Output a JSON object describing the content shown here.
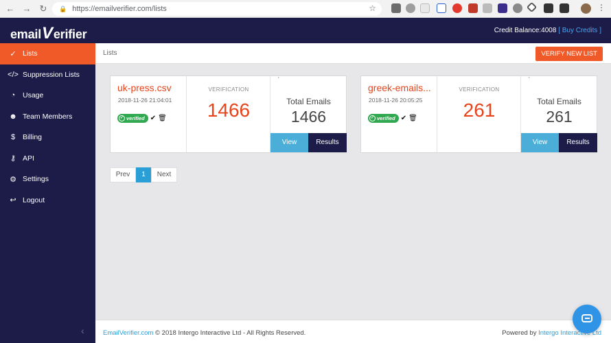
{
  "browser": {
    "url": "https://emailverifier.com/lists",
    "back_icon": "arrow-left",
    "forward_icon": "arrow-right",
    "reload_icon": "reload"
  },
  "header": {
    "logo_part1": "email",
    "logo_v": "V",
    "logo_part2": "erifier",
    "credit_label": "Credit Balance:4008",
    "buy_open": "[",
    "buy_credits": "Buy Credits",
    "buy_close": "]"
  },
  "sidebar": {
    "items": [
      {
        "label": "Lists",
        "icon": "check-circle"
      },
      {
        "label": "Suppression Lists",
        "icon": "code"
      },
      {
        "label": "Usage",
        "icon": "pie-chart"
      },
      {
        "label": "Team Members",
        "icon": "users"
      },
      {
        "label": "Billing",
        "icon": "dollar"
      },
      {
        "label": "API",
        "icon": "key"
      },
      {
        "label": "Settings",
        "icon": "gear"
      },
      {
        "label": "Logout",
        "icon": "logout"
      }
    ]
  },
  "page": {
    "title": "Lists",
    "verify_button": "VERIFY NEW LIST"
  },
  "cards": [
    {
      "filename": "uk-press.csv",
      "date": "2018-11-26 21:04:01",
      "status": "verified",
      "verification_label": "VERIFICATION",
      "verification_value": "1466",
      "total_label": "Total Emails",
      "total_value": "1466",
      "view_label": "View",
      "results_label": "Results"
    },
    {
      "filename": "greek-emails...",
      "date": "2018-11-26 20:05:25",
      "status": "verified",
      "verification_label": "VERIFICATION",
      "verification_value": "261",
      "total_label": "Total Emails",
      "total_value": "261",
      "view_label": "View",
      "results_label": "Results"
    }
  ],
  "pagination": {
    "prev": "Prev",
    "current": "1",
    "next": "Next"
  },
  "footer": {
    "site_link": "EmailVerifier.com",
    "copyright": " © 2018 Intergo Interactive Ltd - All Rights Reserved.",
    "powered_by": "Powered by ",
    "company_link": "Intergo Interactive Ltd"
  },
  "colors": {
    "accent": "#f05a28",
    "navy": "#1d1c48",
    "blue": "#4aaed9",
    "verified_green": "#2fa84f"
  }
}
